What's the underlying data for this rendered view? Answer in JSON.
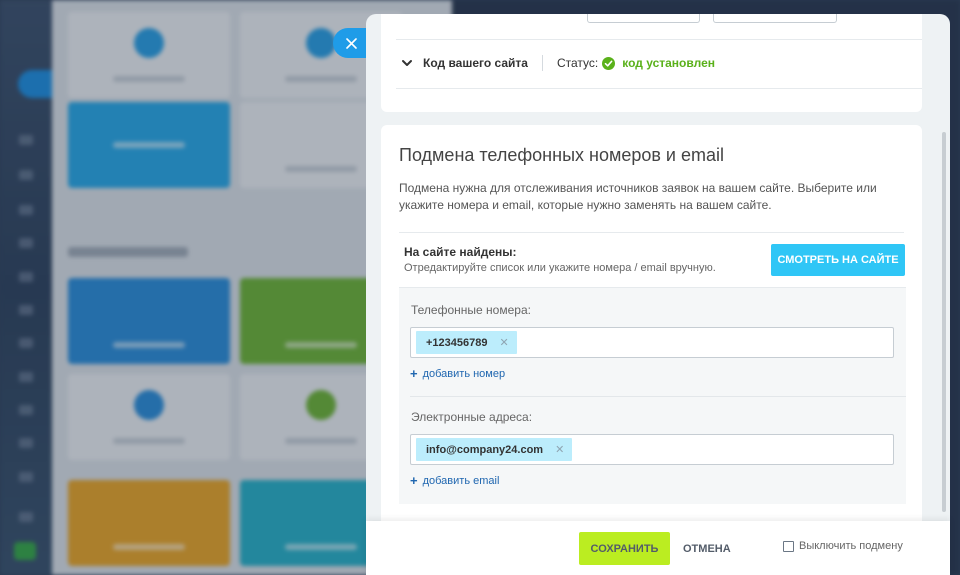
{
  "code_section": {
    "label": "Код вашего сайта",
    "status_label": "Статус:",
    "status_value": "код установлен"
  },
  "substitution": {
    "title": "Подмена телефонных номеров и email",
    "description": "Подмена нужна для отслеживания источников заявок на вашем сайте. Выберите или укажите номера и email, которые нужно заменять на вашем сайте.",
    "found_title": "На сайте найдены:",
    "found_subtitle": "Отредактируйте список или укажите номера / email вручную.",
    "view_button": "СМОТРЕТЬ НА САЙТЕ",
    "phones": {
      "label": "Телефонные номера:",
      "tags": [
        "+123456789"
      ],
      "add_label": "добавить номер"
    },
    "emails": {
      "label": "Электронные адреса:",
      "tags": [
        "info@company24.com"
      ],
      "add_label": "добавить email"
    }
  },
  "footer": {
    "save": "СОХРАНИТЬ",
    "cancel": "ОТМЕНА",
    "disable_label": "Выключить подмену",
    "disable_checked": false
  },
  "colors": {
    "accent_blue": "#2fc6f6",
    "save_green": "#bbed21",
    "status_green": "#5ab11a",
    "tag_bg": "#bcedfc",
    "link_blue": "#2067b0"
  },
  "icons": {
    "close": "close-icon",
    "chevron": "chevron-down-icon",
    "status": "check-circle-icon",
    "tag_remove": "remove-tag-icon",
    "add": "plus-icon"
  }
}
